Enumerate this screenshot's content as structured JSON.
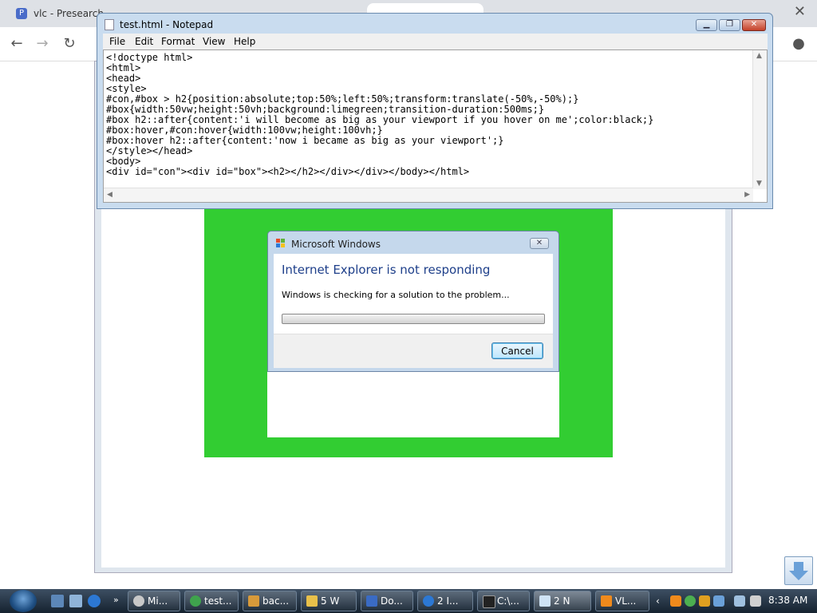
{
  "browser": {
    "tabs": [
      {
        "label": "vlc - Presearch"
      },
      {
        "label": ""
      },
      {
        "label": ""
      },
      {
        "label": ""
      }
    ]
  },
  "notepad": {
    "title": "test.html - Notepad",
    "menu": [
      "File",
      "Edit",
      "Format",
      "View",
      "Help"
    ],
    "content": "<!doctype html>\n<html>\n<head>\n<style>\n#con,#box > h2{position:absolute;top:50%;left:50%;transform:translate(-50%,-50%);}\n#box{width:50vw;height:50vh;background:limegreen;transition-duration:500ms;}\n#box h2::after{content:'i will become as big as your viewport if you hover on me';color:black;}\n#box:hover,#con:hover{width:100vw;height:100vh;}\n#box:hover h2::after{content:'now i became as big as your viewport';}\n</style></head>\n<body>\n<div id=\"con\"><div id=\"box\"><h2></h2></div></div></body></html>"
  },
  "dialog": {
    "title": "Microsoft Windows",
    "heading": "Internet Explorer is not responding",
    "message": "Windows is checking for a solution to the problem...",
    "cancel_label": "Cancel"
  },
  "colors": {
    "page_green": "#32cd32",
    "dialog_heading": "#1e3f8a"
  },
  "taskbar": {
    "buttons": [
      {
        "label": "Mi...",
        "icon": "media-icon"
      },
      {
        "label": "test...",
        "icon": "chrome-icon"
      },
      {
        "label": "bac...",
        "icon": "brush-icon"
      },
      {
        "label": "5 W",
        "icon": "folder-icon"
      },
      {
        "label": "Do...",
        "icon": "document-icon"
      },
      {
        "label": "2 I...",
        "icon": "ie-icon"
      },
      {
        "label": "C:\\...",
        "icon": "cmd-icon"
      },
      {
        "label": "2 N",
        "icon": "notepad-icon"
      },
      {
        "label": "VL...",
        "icon": "vlc-icon"
      }
    ],
    "clock": "8:38 AM"
  }
}
